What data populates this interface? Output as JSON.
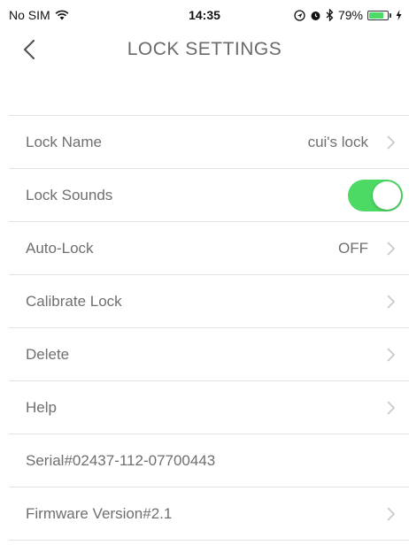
{
  "status_bar": {
    "carrier": "No SIM",
    "time": "14:35",
    "battery_percent": "79%",
    "battery_level": 0.79,
    "icons": [
      "wifi-icon",
      "location-icon",
      "alarm-icon",
      "bluetooth-icon",
      "charging-icon"
    ]
  },
  "nav": {
    "title": "LOCK SETTINGS",
    "back_icon": "chevron-left-icon"
  },
  "settings": {
    "lock_name": {
      "label": "Lock Name",
      "value": "cui's lock"
    },
    "lock_sounds": {
      "label": "Lock Sounds",
      "enabled": true
    },
    "auto_lock": {
      "label": "Auto-Lock",
      "value": "OFF"
    },
    "calibrate_lock": {
      "label": "Calibrate Lock"
    },
    "delete": {
      "label": "Delete"
    },
    "help": {
      "label": "Help"
    },
    "serial": {
      "label": "Serial#02437-112-07700443"
    },
    "firmware": {
      "label": "Firmware Version#2.1"
    }
  },
  "colors": {
    "toggle_on": "#4cd964",
    "text": "#6f6f6f",
    "separator": "#e2e2e2",
    "chevron": "#c7c7cc"
  }
}
